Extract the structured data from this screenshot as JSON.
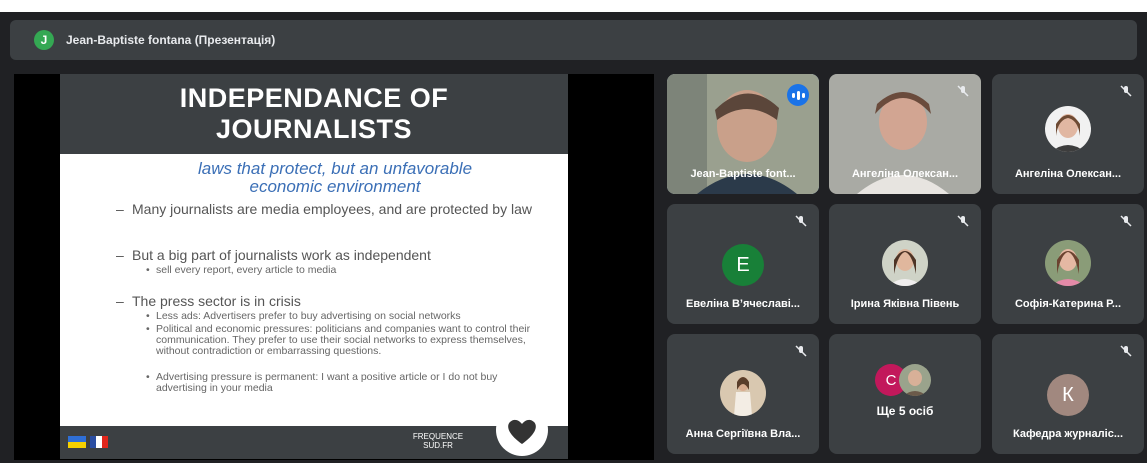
{
  "header": {
    "presenter_initial": "J",
    "presenter_title": "Jean-Baptiste fontana (Презентація)"
  },
  "slide": {
    "title": "INDEPENDANCE OF JOURNALISTS",
    "subtitle": "laws that protect, but an unfavorable economic environment",
    "bullets": [
      {
        "text": "Many journalists are media employees, and are protected by law",
        "subs": []
      },
      {
        "text": "But a big part of journalists work as independent",
        "subs": [
          "sell every report, every article to media"
        ]
      },
      {
        "text": "The press sector is in crisis",
        "subs": [
          "Less ads: Advertisers prefer to buy advertising on social networks",
          "Political and economic pressures: politicians and companies want to control their communication. They prefer to use their social networks to express themselves, without contradiction or embarrassing questions.",
          "Advertising pressure is permanent: I want a positive article or I do not buy advertising in your media"
        ]
      }
    ],
    "brand": "FREQUENCE SUD.FR"
  },
  "participants": [
    {
      "name": "Jean-Baptiste font...",
      "speaking": true
    },
    {
      "name": "Ангеліна Олексан..."
    },
    {
      "name": "Ангеліна Олексан..."
    },
    {
      "name": "Евеліна В’ячеславі...",
      "initial": "E"
    },
    {
      "name": "Ірина Яківна Півень"
    },
    {
      "name": "Софія-Катерина Р..."
    },
    {
      "name": "Анна Сергіївна Вла..."
    },
    {
      "name": "Ще 5 осіб",
      "initial": "C"
    },
    {
      "name": "Кафедра журналіс...",
      "initial": "К"
    }
  ],
  "icons": {
    "mute": "mic-off-icon",
    "speaking": "audio-level-icon"
  },
  "colors": {
    "background": "#202124",
    "tile": "#3c4043",
    "active_outline": "#8ab4f8",
    "presenter_avatar": "#34a853",
    "avatar_e": "#188038",
    "avatar_c": "#c2185b",
    "avatar_k": "#a1887f"
  }
}
